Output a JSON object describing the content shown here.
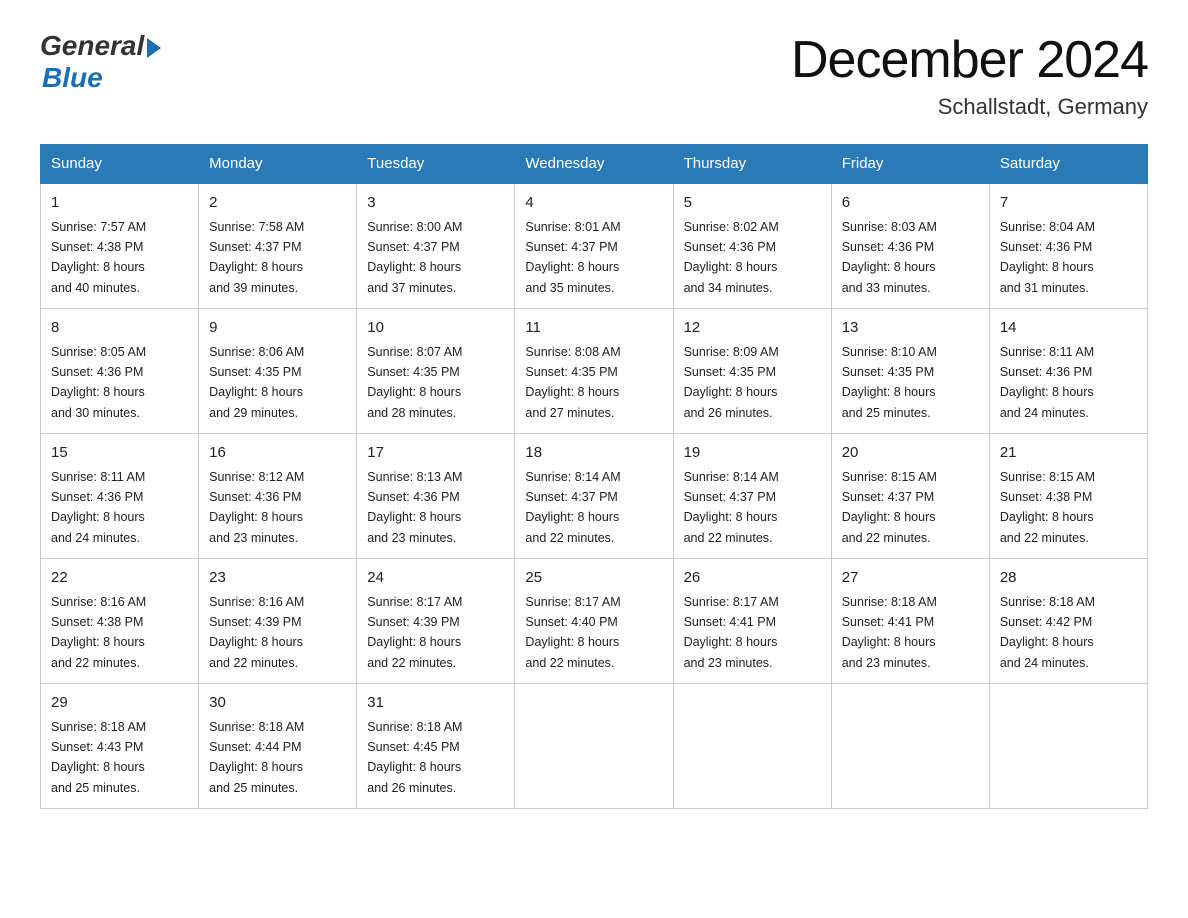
{
  "logo": {
    "text_general": "General",
    "text_blue": "Blue"
  },
  "title": {
    "month_year": "December 2024",
    "location": "Schallstadt, Germany"
  },
  "headers": [
    "Sunday",
    "Monday",
    "Tuesday",
    "Wednesday",
    "Thursday",
    "Friday",
    "Saturday"
  ],
  "weeks": [
    [
      {
        "day": "1",
        "info": "Sunrise: 7:57 AM\nSunset: 4:38 PM\nDaylight: 8 hours\nand 40 minutes."
      },
      {
        "day": "2",
        "info": "Sunrise: 7:58 AM\nSunset: 4:37 PM\nDaylight: 8 hours\nand 39 minutes."
      },
      {
        "day": "3",
        "info": "Sunrise: 8:00 AM\nSunset: 4:37 PM\nDaylight: 8 hours\nand 37 minutes."
      },
      {
        "day": "4",
        "info": "Sunrise: 8:01 AM\nSunset: 4:37 PM\nDaylight: 8 hours\nand 35 minutes."
      },
      {
        "day": "5",
        "info": "Sunrise: 8:02 AM\nSunset: 4:36 PM\nDaylight: 8 hours\nand 34 minutes."
      },
      {
        "day": "6",
        "info": "Sunrise: 8:03 AM\nSunset: 4:36 PM\nDaylight: 8 hours\nand 33 minutes."
      },
      {
        "day": "7",
        "info": "Sunrise: 8:04 AM\nSunset: 4:36 PM\nDaylight: 8 hours\nand 31 minutes."
      }
    ],
    [
      {
        "day": "8",
        "info": "Sunrise: 8:05 AM\nSunset: 4:36 PM\nDaylight: 8 hours\nand 30 minutes."
      },
      {
        "day": "9",
        "info": "Sunrise: 8:06 AM\nSunset: 4:35 PM\nDaylight: 8 hours\nand 29 minutes."
      },
      {
        "day": "10",
        "info": "Sunrise: 8:07 AM\nSunset: 4:35 PM\nDaylight: 8 hours\nand 28 minutes."
      },
      {
        "day": "11",
        "info": "Sunrise: 8:08 AM\nSunset: 4:35 PM\nDaylight: 8 hours\nand 27 minutes."
      },
      {
        "day": "12",
        "info": "Sunrise: 8:09 AM\nSunset: 4:35 PM\nDaylight: 8 hours\nand 26 minutes."
      },
      {
        "day": "13",
        "info": "Sunrise: 8:10 AM\nSunset: 4:35 PM\nDaylight: 8 hours\nand 25 minutes."
      },
      {
        "day": "14",
        "info": "Sunrise: 8:11 AM\nSunset: 4:36 PM\nDaylight: 8 hours\nand 24 minutes."
      }
    ],
    [
      {
        "day": "15",
        "info": "Sunrise: 8:11 AM\nSunset: 4:36 PM\nDaylight: 8 hours\nand 24 minutes."
      },
      {
        "day": "16",
        "info": "Sunrise: 8:12 AM\nSunset: 4:36 PM\nDaylight: 8 hours\nand 23 minutes."
      },
      {
        "day": "17",
        "info": "Sunrise: 8:13 AM\nSunset: 4:36 PM\nDaylight: 8 hours\nand 23 minutes."
      },
      {
        "day": "18",
        "info": "Sunrise: 8:14 AM\nSunset: 4:37 PM\nDaylight: 8 hours\nand 22 minutes."
      },
      {
        "day": "19",
        "info": "Sunrise: 8:14 AM\nSunset: 4:37 PM\nDaylight: 8 hours\nand 22 minutes."
      },
      {
        "day": "20",
        "info": "Sunrise: 8:15 AM\nSunset: 4:37 PM\nDaylight: 8 hours\nand 22 minutes."
      },
      {
        "day": "21",
        "info": "Sunrise: 8:15 AM\nSunset: 4:38 PM\nDaylight: 8 hours\nand 22 minutes."
      }
    ],
    [
      {
        "day": "22",
        "info": "Sunrise: 8:16 AM\nSunset: 4:38 PM\nDaylight: 8 hours\nand 22 minutes."
      },
      {
        "day": "23",
        "info": "Sunrise: 8:16 AM\nSunset: 4:39 PM\nDaylight: 8 hours\nand 22 minutes."
      },
      {
        "day": "24",
        "info": "Sunrise: 8:17 AM\nSunset: 4:39 PM\nDaylight: 8 hours\nand 22 minutes."
      },
      {
        "day": "25",
        "info": "Sunrise: 8:17 AM\nSunset: 4:40 PM\nDaylight: 8 hours\nand 22 minutes."
      },
      {
        "day": "26",
        "info": "Sunrise: 8:17 AM\nSunset: 4:41 PM\nDaylight: 8 hours\nand 23 minutes."
      },
      {
        "day": "27",
        "info": "Sunrise: 8:18 AM\nSunset: 4:41 PM\nDaylight: 8 hours\nand 23 minutes."
      },
      {
        "day": "28",
        "info": "Sunrise: 8:18 AM\nSunset: 4:42 PM\nDaylight: 8 hours\nand 24 minutes."
      }
    ],
    [
      {
        "day": "29",
        "info": "Sunrise: 8:18 AM\nSunset: 4:43 PM\nDaylight: 8 hours\nand 25 minutes."
      },
      {
        "day": "30",
        "info": "Sunrise: 8:18 AM\nSunset: 4:44 PM\nDaylight: 8 hours\nand 25 minutes."
      },
      {
        "day": "31",
        "info": "Sunrise: 8:18 AM\nSunset: 4:45 PM\nDaylight: 8 hours\nand 26 minutes."
      },
      {
        "day": "",
        "info": ""
      },
      {
        "day": "",
        "info": ""
      },
      {
        "day": "",
        "info": ""
      },
      {
        "day": "",
        "info": ""
      }
    ]
  ]
}
